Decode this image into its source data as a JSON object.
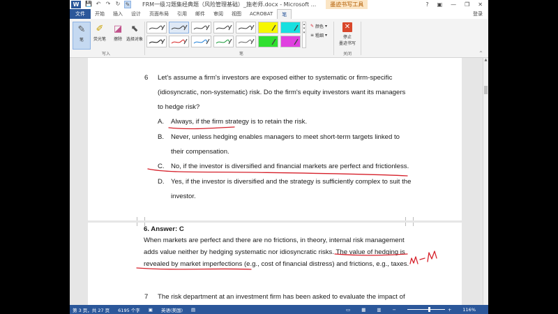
{
  "window": {
    "app_logo": "W",
    "doc_title": "FRM一级习题集经典题（风险管理基础）_施老师.docx - Microsoft ...",
    "context_tab_title": "墨迹书写工具",
    "help": "?",
    "login": "登录"
  },
  "quick_access": [
    "💾",
    "↶",
    "↷",
    "↻",
    "✎"
  ],
  "tabs": [
    "文件",
    "开始",
    "插入",
    "设计",
    "页面布局",
    "引用",
    "邮件",
    "审阅",
    "视图",
    "ACROBAT",
    "笔"
  ],
  "ribbon": {
    "tools": [
      {
        "label": "笔",
        "icon": "pen-icon"
      },
      {
        "label": "荧光笔",
        "icon": "highlighter-icon"
      },
      {
        "label": "擦除",
        "icon": "eraser-icon"
      },
      {
        "label": "选择对象",
        "icon": "select-object-icon"
      }
    ],
    "group_write": "写入",
    "group_pens": "笔",
    "group_close": "关闭",
    "color_label": "颜色",
    "thickness_label": "粗细",
    "stop_label_1": "停止",
    "stop_label_2": "墨迹书写",
    "swatch_colors": [
      "#3a3a3a",
      "#3a3a3a",
      "#3a3a3a",
      "#3a3a3a",
      "#3a3a3a",
      "#f7f700",
      "#18e0e0",
      "#111111",
      "#d62020",
      "#1f7fd6",
      "#1a9a3a",
      "#666666",
      "#30e030",
      "#e040e0"
    ]
  },
  "document": {
    "q6_num": "6",
    "q6_lines": [
      "Let's assume a firm's investors are exposed either to systematic or firm-specific",
      "(idiosyncratic, non-systematic) risk. Do the firm's equity investors want its managers",
      "to hedge risk?"
    ],
    "options": [
      {
        "letter": "A.",
        "lines": [
          "Always, if the firm strategy is to retain the risk."
        ]
      },
      {
        "letter": "B.",
        "lines": [
          "Never, unless hedging enables managers to meet short-term targets linked to",
          "their compensation."
        ]
      },
      {
        "letter": "C.",
        "lines": [
          "No, if the investor is diversified and financial markets are perfect and frictionless."
        ]
      },
      {
        "letter": "D.",
        "lines": [
          "Yes, if the investor is diversified and the strategy is sufficiently complex to suit the",
          "investor."
        ]
      }
    ],
    "answer_head": "6.    Answer: C",
    "answer_lines": [
      "When markets are perfect and there are no frictions, in theory, internal risk management",
      "adds value neither by hedging systematic nor idiosyncratic risks. The value of hedging is",
      "revealed by market imperfections (e.g., cost of financial distress) and frictions, e.g., taxes."
    ],
    "q7_num": "7",
    "q7_line": "The risk department at an investment firm has been asked to evaluate the impact of"
  },
  "ink_note": "m-m",
  "ink_color": "#d6202a",
  "status": {
    "page": "第 3 页，共 27 页",
    "words": "6195 个字",
    "lang": "英语(美国)",
    "zoom": "116%"
  }
}
